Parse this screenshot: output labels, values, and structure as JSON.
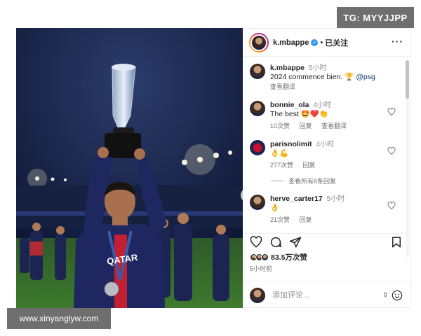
{
  "watermark_top": "TG: MYYJJPP",
  "watermark_bottom": "www.xinyanglyw.com",
  "post": {
    "username": "k.mbappe",
    "verified_glyph": "✓",
    "follow_label": "已关注",
    "separator": "•",
    "more_label": "···",
    "next_label": "›",
    "caption": {
      "username": "k.mbappe",
      "time": "5小时",
      "text": "2024 commence bien. 🏆",
      "mention": "@psg",
      "translate": "查看翻译"
    },
    "comments": [
      {
        "username": "bonnie_ola",
        "time": "4小时",
        "text": "The best 🤩❤️👏",
        "likes": "10次赞",
        "reply": "回复",
        "translate": "查看翻译"
      },
      {
        "username": "parisnolimit",
        "time": "4小时",
        "text": "👌💪",
        "likes": "277次赞",
        "reply": "回复",
        "view_replies": "查看所有6条回复"
      },
      {
        "username": "herve_carter17",
        "time": "5小时",
        "text": "👌",
        "likes": "21次赞",
        "reply": "回复"
      }
    ],
    "likes_text": "83.5万次赞",
    "posted_time": "5小时前",
    "composer_placeholder": "添加评论...",
    "sort_glyph": "⇕"
  },
  "icons": {
    "like": "heart-icon",
    "comment": "comment-icon",
    "share": "share-icon",
    "save": "bookmark-icon",
    "emoji": "emoji-icon"
  }
}
